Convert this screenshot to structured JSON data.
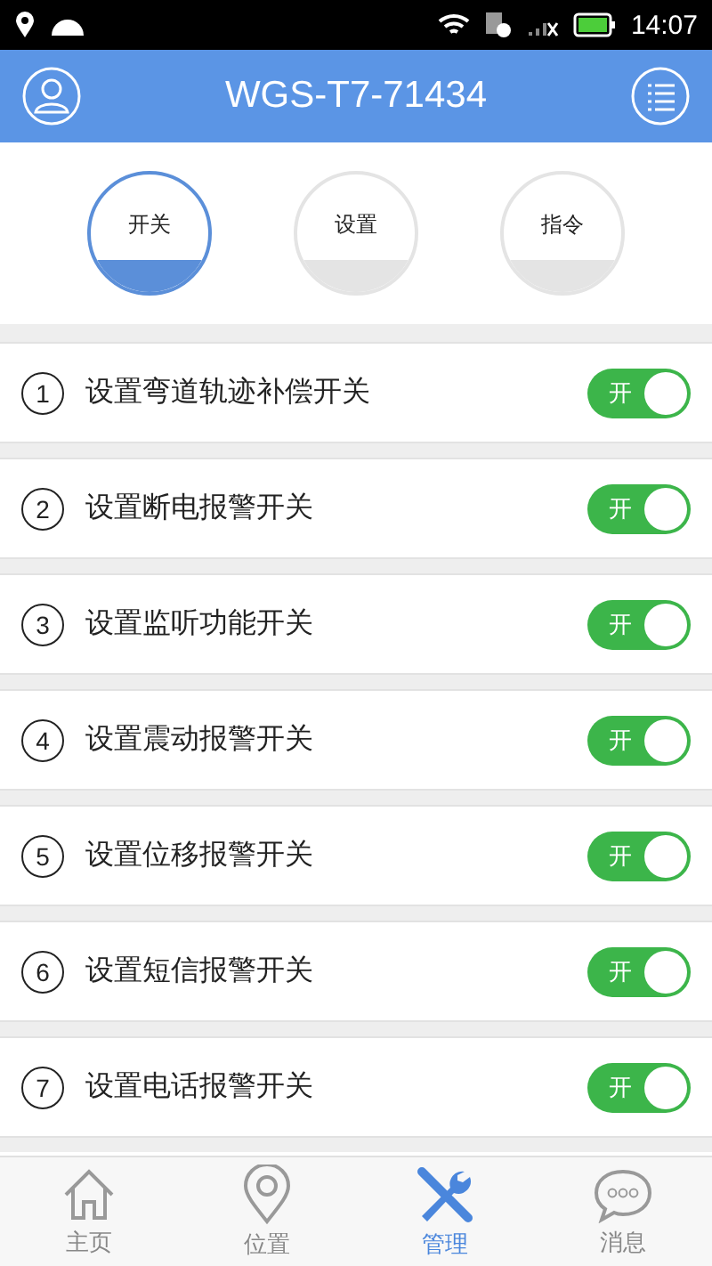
{
  "status_bar": {
    "time": "14:07"
  },
  "header": {
    "title": "WGS-T7-71434"
  },
  "tabs": [
    {
      "label": "开关",
      "selected": true
    },
    {
      "label": "设置",
      "selected": false
    },
    {
      "label": "指令",
      "selected": false
    }
  ],
  "switches": [
    {
      "number": "1",
      "label": "设置弯道轨迹补偿开关",
      "toggle_text": "开",
      "on": true
    },
    {
      "number": "2",
      "label": "设置断电报警开关",
      "toggle_text": "开",
      "on": true
    },
    {
      "number": "3",
      "label": "设置监听功能开关",
      "toggle_text": "开",
      "on": true
    },
    {
      "number": "4",
      "label": "设置震动报警开关",
      "toggle_text": "开",
      "on": true
    },
    {
      "number": "5",
      "label": "设置位移报警开关",
      "toggle_text": "开",
      "on": true
    },
    {
      "number": "6",
      "label": "设置短信报警开关",
      "toggle_text": "开",
      "on": true
    },
    {
      "number": "7",
      "label": "设置电话报警开关",
      "toggle_text": "开",
      "on": true
    }
  ],
  "bottom_nav": [
    {
      "label": "主页",
      "kind": "home",
      "selected": false
    },
    {
      "label": "位置",
      "kind": "location",
      "selected": false
    },
    {
      "label": "管理",
      "kind": "tools",
      "selected": true
    },
    {
      "label": "消息",
      "kind": "chat",
      "selected": false
    }
  ]
}
